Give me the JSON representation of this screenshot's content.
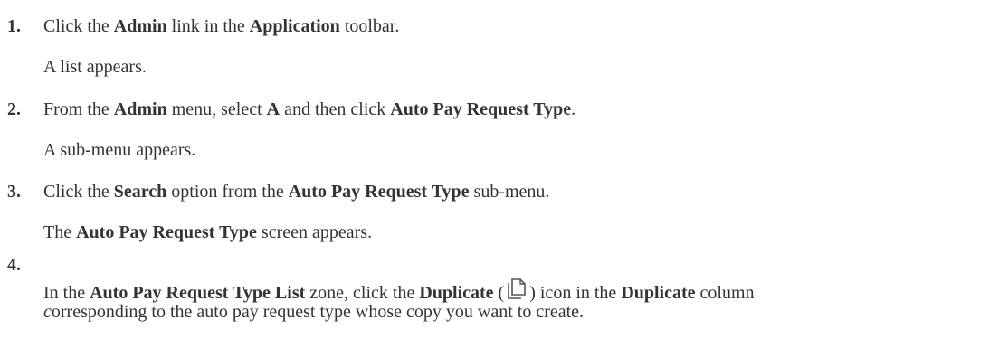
{
  "steps": [
    {
      "number": "1.",
      "parts": [
        "Click the ",
        "Admin",
        " link in the ",
        "Application",
        " toolbar."
      ],
      "result": "A list appears."
    },
    {
      "number": "2.",
      "parts": [
        "From the ",
        "Admin",
        " menu, select ",
        "A",
        " and then click ",
        "Auto Pay Request Type",
        "."
      ],
      "result": "A sub-menu appears."
    },
    {
      "number": "3.",
      "parts": [
        "Click the ",
        "Search",
        " option from the ",
        "Auto Pay Request Type",
        " sub-menu."
      ],
      "result_parts": [
        "The ",
        "Auto Pay Request Type",
        " screen appears."
      ]
    },
    {
      "number": "4.",
      "parts": [
        "In the ",
        "Auto Pay Request Type List",
        " zone, click the ",
        "Duplicate",
        " (",
        ") icon in the ",
        "Duplicate",
        " column"
      ],
      "line2_first": "c",
      "line2_rest": "orresponding to the auto pay request type whose copy you want to create.",
      "icon": "duplicate-icon"
    }
  ]
}
